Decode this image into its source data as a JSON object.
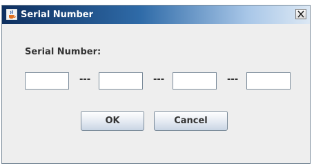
{
  "window": {
    "title": "Serial Number",
    "app_icon": "java-cup-icon",
    "close_icon": "close-icon"
  },
  "form": {
    "label": "Serial Number:",
    "fields": [
      {
        "value": ""
      },
      {
        "value": ""
      },
      {
        "value": ""
      },
      {
        "value": ""
      }
    ],
    "separator": "---"
  },
  "buttons": {
    "ok": "OK",
    "cancel": "Cancel"
  },
  "colors": {
    "title_gradient_start": "#0e2f5f",
    "title_gradient_end": "#dce8f4",
    "dialog_background": "#eeeeee"
  }
}
